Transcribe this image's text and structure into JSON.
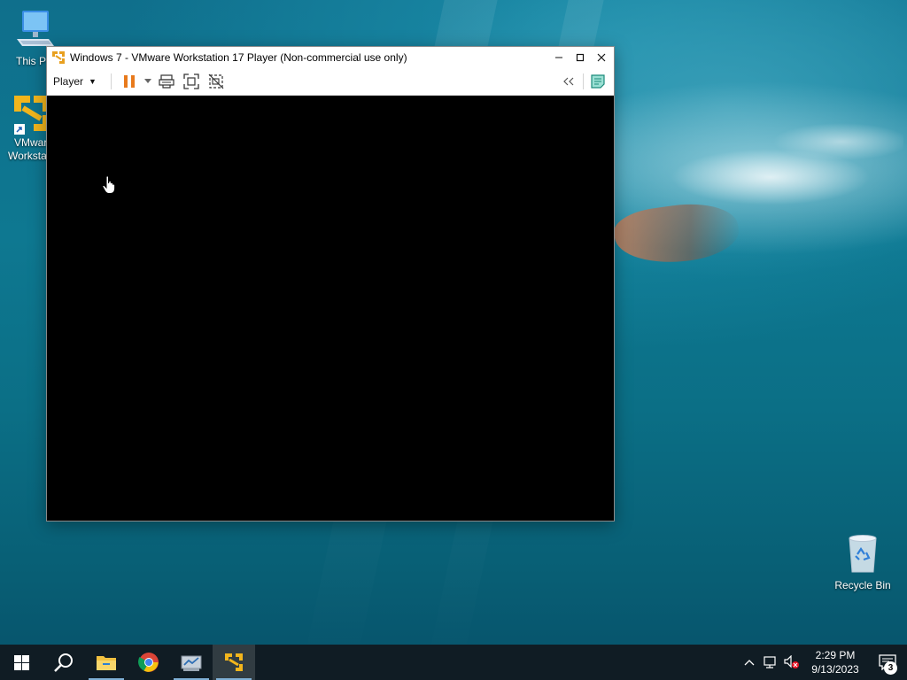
{
  "desktop": {
    "icons": [
      {
        "label": "This PC",
        "icon": "computer-icon"
      },
      {
        "label": "VMware Workstation",
        "icon": "vmware-icon"
      },
      {
        "label": "Recycle Bin",
        "icon": "recycle-bin-icon"
      }
    ],
    "visible_labels": {
      "this_pc": "This P",
      "vmware_line1": "VMwar",
      "vmware_line2": "Workstat"
    }
  },
  "window": {
    "title": "Windows 7 - VMware Workstation 17 Player (Non-commercial use only)",
    "toolbar": {
      "player_menu": "Player",
      "buttons": [
        "pause-icon",
        "send-ctrl-alt-del-icon",
        "full-screen-icon",
        "unity-icon",
        "collapse-icon",
        "message-log-icon"
      ]
    },
    "vm_screen_color": "#000000"
  },
  "taskbar": {
    "pinned": [
      "start-icon",
      "search-icon",
      "file-explorer-icon",
      "chrome-icon",
      "server-manager-icon",
      "vmware-player-icon"
    ],
    "active": "vmware-player-icon",
    "clock": {
      "time": "2:29 PM",
      "date": "9/13/2023"
    },
    "notification_count": "3"
  },
  "colors": {
    "accent": "#e8a020",
    "pause": "#e87a1c",
    "taskbar": "#101c24"
  }
}
